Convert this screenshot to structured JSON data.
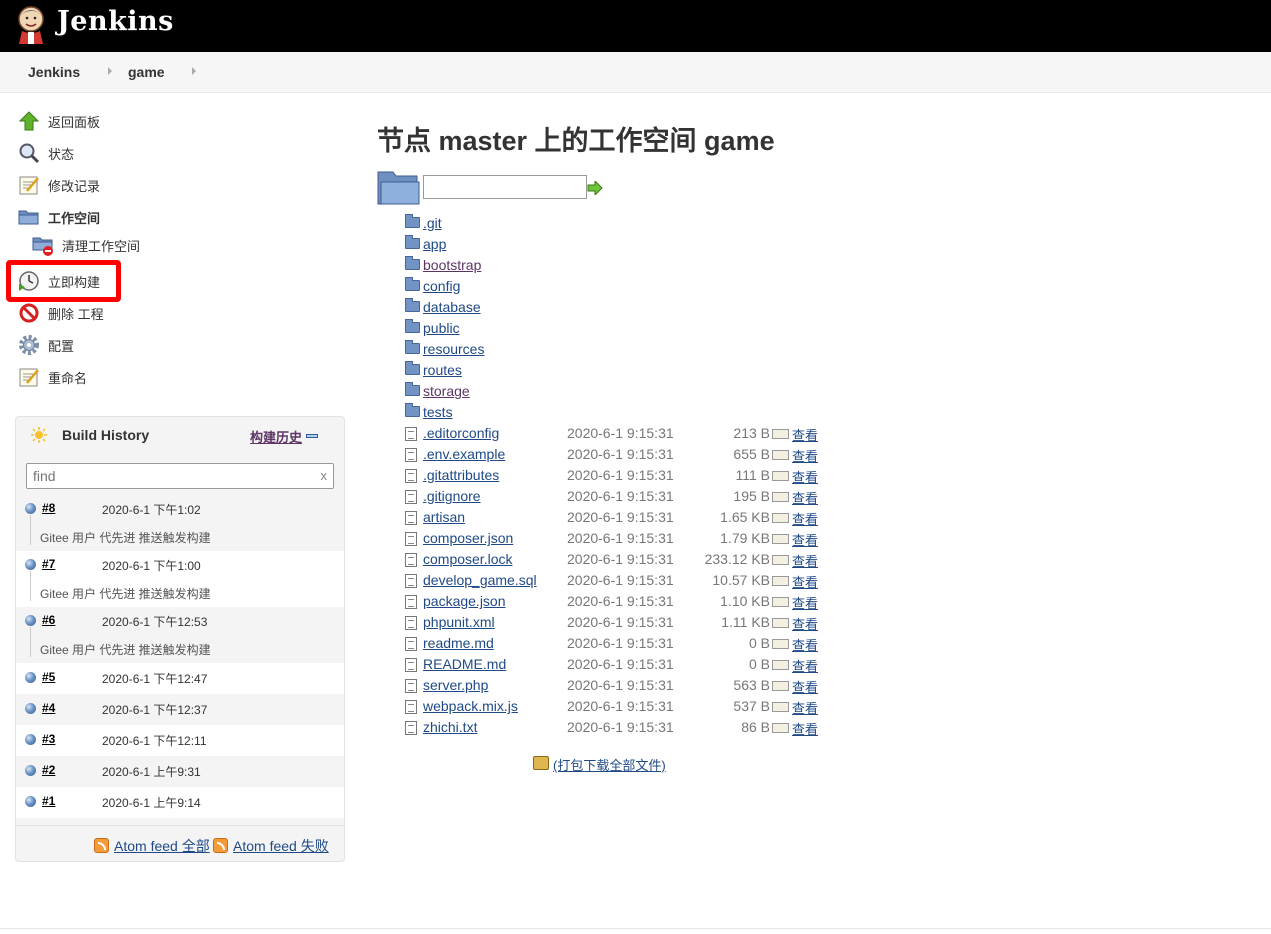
{
  "header": {
    "brand": "Jenkins"
  },
  "breadcrumb": [
    "Jenkins",
    "game"
  ],
  "tasks": [
    {
      "label": "返回面板",
      "icon": "up-arrow-icon"
    },
    {
      "label": "状态",
      "icon": "search-icon"
    },
    {
      "label": "修改记录",
      "icon": "notepad-icon"
    },
    {
      "label": "工作空间",
      "icon": "folder-icon"
    },
    {
      "label": "清理工作空间",
      "icon": "folder-delete-icon"
    },
    {
      "label": "立即构建",
      "icon": "clock-icon"
    },
    {
      "label": "删除 工程",
      "icon": "no-entry-icon"
    },
    {
      "label": "配置",
      "icon": "gear-icon"
    },
    {
      "label": "重命名",
      "icon": "notepad-icon"
    }
  ],
  "build_history": {
    "title": "Build History",
    "trend": "构建历史",
    "search_placeholder": "find",
    "clear": "x",
    "builds": [
      {
        "num": "#8",
        "date": "2020-6-1 下午1:02",
        "cause": "Gitee 用户 代先进 推送触发构建"
      },
      {
        "num": "#7",
        "date": "2020-6-1 下午1:00",
        "cause": "Gitee 用户 代先进 推送触发构建"
      },
      {
        "num": "#6",
        "date": "2020-6-1 下午12:53",
        "cause": "Gitee 用户 代先进 推送触发构建"
      },
      {
        "num": "#5",
        "date": "2020-6-1 下午12:47"
      },
      {
        "num": "#4",
        "date": "2020-6-1 下午12:37"
      },
      {
        "num": "#3",
        "date": "2020-6-1 下午12:11"
      },
      {
        "num": "#2",
        "date": "2020-6-1 上午9:31"
      },
      {
        "num": "#1",
        "date": "2020-6-1 上午9:14"
      }
    ],
    "feed_all": "Atom feed 全部",
    "feed_fail": "Atom feed 失败"
  },
  "main": {
    "title": "节点 master 上的工作空间 game",
    "folders": [
      ".git",
      "app",
      "bootstrap",
      "config",
      "database",
      "public",
      "resources",
      "routes",
      "storage",
      "tests"
    ],
    "files": [
      {
        "name": ".editorconfig",
        "date": "2020-6-1 9:15:31",
        "size": "213 B"
      },
      {
        "name": ".env.example",
        "date": "2020-6-1 9:15:31",
        "size": "655 B"
      },
      {
        "name": ".gitattributes",
        "date": "2020-6-1 9:15:31",
        "size": "111 B"
      },
      {
        "name": ".gitignore",
        "date": "2020-6-1 9:15:31",
        "size": "195 B"
      },
      {
        "name": "artisan",
        "date": "2020-6-1 9:15:31",
        "size": "1.65 KB"
      },
      {
        "name": "composer.json",
        "date": "2020-6-1 9:15:31",
        "size": "1.79 KB"
      },
      {
        "name": "composer.lock",
        "date": "2020-6-1 9:15:31",
        "size": "233.12 KB"
      },
      {
        "name": "develop_game.sql",
        "date": "2020-6-1 9:15:31",
        "size": "10.57 KB"
      },
      {
        "name": "package.json",
        "date": "2020-6-1 9:15:31",
        "size": "1.10 KB"
      },
      {
        "name": "phpunit.xml",
        "date": "2020-6-1 9:15:31",
        "size": "1.11 KB"
      },
      {
        "name": "readme.md",
        "date": "2020-6-1 9:15:31",
        "size": "0 B"
      },
      {
        "name": "README.md",
        "date": "2020-6-1 9:15:31",
        "size": "0 B"
      },
      {
        "name": "server.php",
        "date": "2020-6-1 9:15:31",
        "size": "563 B"
      },
      {
        "name": "webpack.mix.js",
        "date": "2020-6-1 9:15:31",
        "size": "537 B"
      },
      {
        "name": "zhichi.txt",
        "date": "2020-6-1 9:15:31",
        "size": "86 B"
      }
    ],
    "view_label": "查看",
    "zip_label": "(打包下载全部文件)"
  }
}
